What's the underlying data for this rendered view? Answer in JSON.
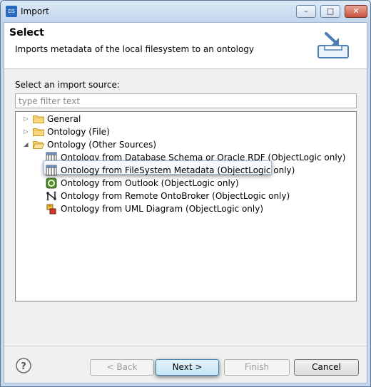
{
  "window": {
    "title": "Import",
    "app_icon_text": "DS",
    "controls": {
      "minimize": "–",
      "maximize": "□",
      "close": "✕"
    }
  },
  "banner": {
    "title": "Select",
    "description": "Imports metadata of the local filesystem to an ontology",
    "icon": "import-tray-icon"
  },
  "source": {
    "label": "Select an import source:",
    "filter_placeholder": "type filter text",
    "filter_value": ""
  },
  "tree": {
    "items": [
      {
        "label": "General",
        "expander": "▷",
        "icon": "folder-icon"
      },
      {
        "label": "Ontology (File)",
        "expander": "▷",
        "icon": "folder-icon"
      },
      {
        "label": "Ontology (Other Sources)",
        "expander": "◢",
        "icon": "folder-icon"
      },
      {
        "label": "Ontology from Database Schema or Oracle RDF (ObjectLogic only)",
        "icon": "database-schema-icon"
      },
      {
        "label": "Ontology from FileSystem Metadata (ObjectLogic only)",
        "icon": "filesystem-icon",
        "selected": true
      },
      {
        "label": "Ontology from Outlook (ObjectLogic only)",
        "icon": "outlook-icon"
      },
      {
        "label": "Ontology from Remote OntoBroker (ObjectLogic only)",
        "icon": "ontobroker-icon"
      },
      {
        "label": "Ontology from UML Diagram (ObjectLogic only)",
        "icon": "uml-diagram-icon"
      }
    ]
  },
  "buttons": {
    "help": "?",
    "back": "< Back",
    "next": "Next >",
    "finish": "Finish",
    "cancel": "Cancel"
  },
  "colors": {
    "window_frame": "#c4d7ec",
    "dialog_bg": "#f0f0f0",
    "next_button": "#c4e5f6",
    "selection_border": "#9fb7d3"
  }
}
